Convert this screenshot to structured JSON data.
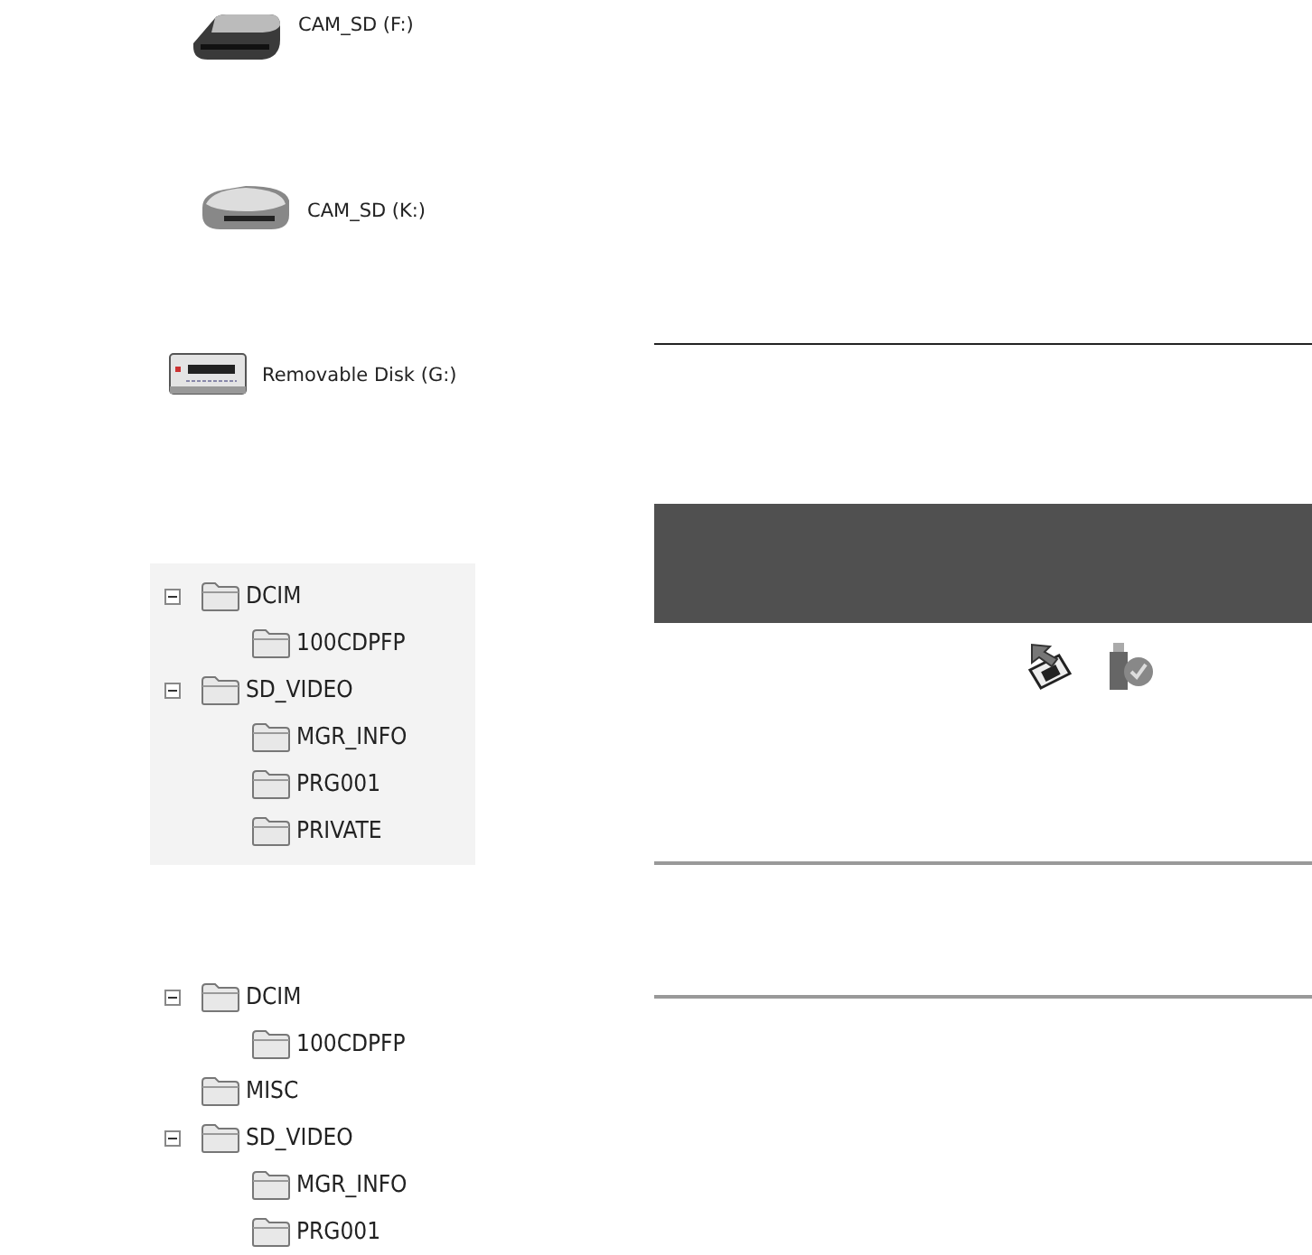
{
  "drives": [
    {
      "label": "CAM_SD (F:)",
      "kind": "reader-dark"
    },
    {
      "label": "CAM_SD (K:)",
      "kind": "reader-light"
    },
    {
      "label": "Removable Disk (G:)",
      "kind": "removable"
    }
  ],
  "trees": [
    {
      "shaded": true,
      "items": [
        {
          "name": "DCIM",
          "expanded": true,
          "children": [
            {
              "name": "100CDPFP"
            }
          ]
        },
        {
          "name": "SD_VIDEO",
          "expanded": true,
          "children": [
            {
              "name": "MGR_INFO"
            },
            {
              "name": "PRG001"
            },
            {
              "name": "PRIVATE"
            }
          ]
        }
      ]
    },
    {
      "shaded": false,
      "items": [
        {
          "name": "DCIM",
          "expanded": true,
          "children": [
            {
              "name": "100CDPFP"
            }
          ]
        },
        {
          "name": "MISC"
        },
        {
          "name": "SD_VIDEO",
          "expanded": true,
          "children": [
            {
              "name": "MGR_INFO"
            },
            {
              "name": "PRG001"
            }
          ]
        }
      ]
    }
  ],
  "side_icons": [
    {
      "kind": "arrow-device"
    },
    {
      "kind": "usb-check"
    }
  ]
}
